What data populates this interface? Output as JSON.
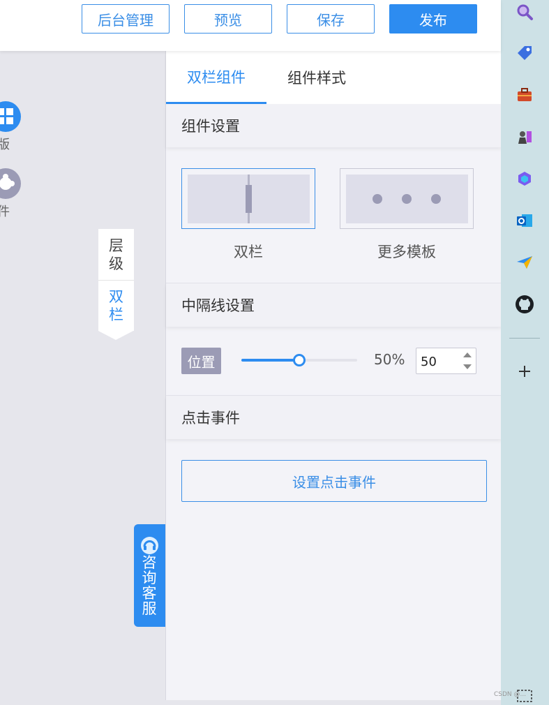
{
  "header": {
    "buttons": [
      "后台管理",
      "预览",
      "保存",
      "发布"
    ]
  },
  "canvas": {
    "left_tools": [
      "模版",
      "组件"
    ],
    "layer_tab": {
      "label": "层级",
      "current": "双栏"
    },
    "consult_label": "咨询客服"
  },
  "panel": {
    "tabs": [
      "双栏组件",
      "组件样式"
    ],
    "component_settings": {
      "title": "组件设置",
      "templates": [
        "双栏",
        "更多模板"
      ]
    },
    "divider_settings": {
      "title": "中隔线设置",
      "position_label": "位置",
      "position_percent": "50%",
      "position_value": "50",
      "slider_value": 0.5
    },
    "click_event": {
      "title": "点击事件",
      "button_label": "设置点击事件"
    }
  },
  "browser_sidebar": {
    "icons": [
      "search-icon",
      "tag-icon",
      "toolbox-icon",
      "chess-icon",
      "copilot-icon",
      "outlook-icon",
      "send-icon",
      "github-icon",
      "add-icon",
      "screenshot-icon"
    ]
  },
  "watermark": "CSDN @..."
}
